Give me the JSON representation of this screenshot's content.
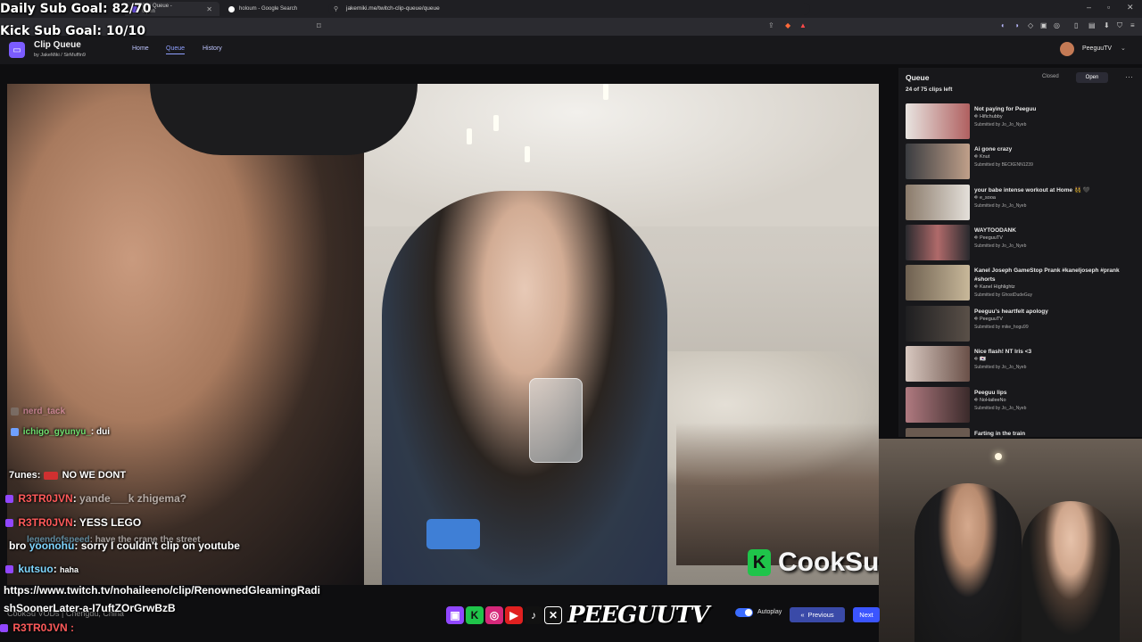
{
  "overlay": {
    "daily_goal": "Daily Sub Goal: 82/70",
    "kick_goal": "Kick Sub Goal: 10/10"
  },
  "browser": {
    "tabs": [
      {
        "label": "Clip Queue - Open",
        "active": true
      },
      {
        "label": "holoum - Google Search",
        "active": false
      }
    ],
    "url": "jakemiki.me/twitch-clip-queue/queue"
  },
  "app": {
    "title": "Clip Queue",
    "subtitle": "by JakeMiki / SirMuffin9",
    "nav": [
      {
        "label": "Home",
        "active": false
      },
      {
        "label": "Queue",
        "active": true
      },
      {
        "label": "History",
        "active": false
      }
    ],
    "user": "PeeguuTV"
  },
  "queue": {
    "title": "Queue",
    "count": "24 of 75 clips left",
    "closed_label": "Closed",
    "open_label": "Open",
    "items": [
      {
        "title": "Not paying for Peeguu",
        "channel": "Hifichubby",
        "submitted": "Submitted by Jo_Jo_Nyeb",
        "thumb": "#b06060"
      },
      {
        "title": "Ai gone crazy",
        "channel": "Knut",
        "submitted": "Submitted by BECKENN1239",
        "thumb": "#7c6c60"
      },
      {
        "title": "your babe intense workout at Home 👯 🖤",
        "channel": "e_sooa",
        "submitted": "Submitted by Jo_Jo_Nyeb",
        "thumb": "#c8c2bc"
      },
      {
        "title": "WAYTOODANK",
        "channel": "PeeguuTV",
        "submitted": "Submitted by Jo_Jo_Nyeb",
        "thumb": "#7a4a4a"
      },
      {
        "title": "Kanel Joseph GameStop Prank #kaneljoseph #prank #shorts",
        "channel": "Kanel Highlightz",
        "submitted": "Submitted by GhostDudeGuy",
        "thumb": "#8a7e6a"
      },
      {
        "title": "Peeguu's heartfelt apology",
        "channel": "PeeguuTV",
        "submitted": "Submitted by mike_hogu99",
        "thumb": "#3c3a38"
      },
      {
        "title": "Nice flash! NT Iris <3",
        "channel": "🇰🇷",
        "submitted": "Submitted by Jo_Jo_Nyeb",
        "thumb": "#a08a84"
      },
      {
        "title": "Peeguu lips",
        "channel": "NoHaileeNo",
        "submitted": "Submitted by Jo_Jo_Nyeb",
        "thumb": "#9a6a70"
      },
      {
        "title": "Farting in the train",
        "channel": "",
        "submitted": "",
        "thumb": "#6a5a50"
      }
    ]
  },
  "chat": [
    {
      "name": "nerd_tack",
      "text": "",
      "color": "#ff9fd0",
      "faded": true
    },
    {
      "name": "ichigo_gyunyu_",
      "text": "dui",
      "color": "#6fe06f",
      "faded": false
    },
    {
      "name": "7unes",
      "text": "NO WE DONT",
      "color": "#ffffff",
      "faded": false
    },
    {
      "name": "R3TR0JVN",
      "text": "yande___k zhigema?",
      "color": "#ff5a5a",
      "faded": true
    },
    {
      "name": "R3TR0JVN",
      "text": "YESS LEGO",
      "color": "#ff5a5a",
      "faded": false
    },
    {
      "name": "legendofspeed",
      "text": "have the crane the street",
      "color": "#7fd6ff",
      "faded": true
    },
    {
      "name": "bro",
      "text": "sorry I couldn't clip on youtube",
      "color": "#ffffff",
      "faded": false
    },
    {
      "name": "kutsuo",
      "text": "haha",
      "color": "#7fd6ff",
      "faded": false
    }
  ],
  "video": {
    "watermark": "CookSu"
  },
  "bottom": {
    "link": "https://www.twitch.tv/nohaileeno/clip/RenownedGleamingRadishSoonerLater-a-I7uftZOrGrwBzB",
    "credit": "CookSu VODs | Chengdu, China",
    "last_chat_name": "R3TR0JVN",
    "brand": "PEEGUUTV",
    "autoplay_label": "Autoplay",
    "prev_label": "Previous",
    "next_label": "Next"
  },
  "colors": {
    "accent": "#3b55ff",
    "brand_purple": "#7b5cff",
    "panel": "#18181b"
  }
}
